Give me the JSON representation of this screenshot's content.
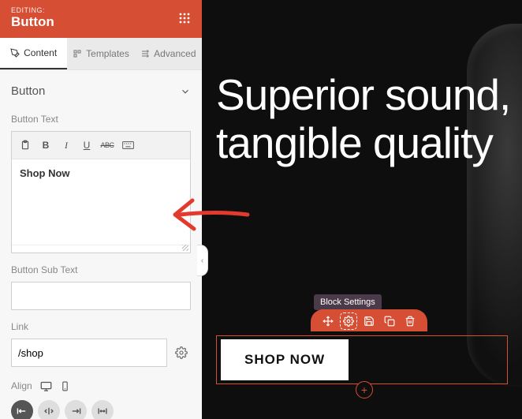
{
  "header": {
    "editing_label": "EDITING:",
    "title": "Button"
  },
  "tabs": {
    "content": "Content",
    "templates": "Templates",
    "advanced": "Advanced"
  },
  "section": {
    "title": "Button"
  },
  "button_text": {
    "label": "Button Text",
    "value": "Shop Now",
    "toolbar": {
      "bold": "B",
      "italic": "I",
      "underline": "U",
      "strike": "ABC"
    }
  },
  "sub_text": {
    "label": "Button Sub Text",
    "value": ""
  },
  "link": {
    "label": "Link",
    "value": "/shop"
  },
  "align": {
    "label": "Align"
  },
  "preview": {
    "hero": "Superior sound, tangible quality",
    "cta": "SHOP NOW",
    "tooltip": "Block Settings"
  },
  "colors": {
    "accent": "#d64e33"
  }
}
